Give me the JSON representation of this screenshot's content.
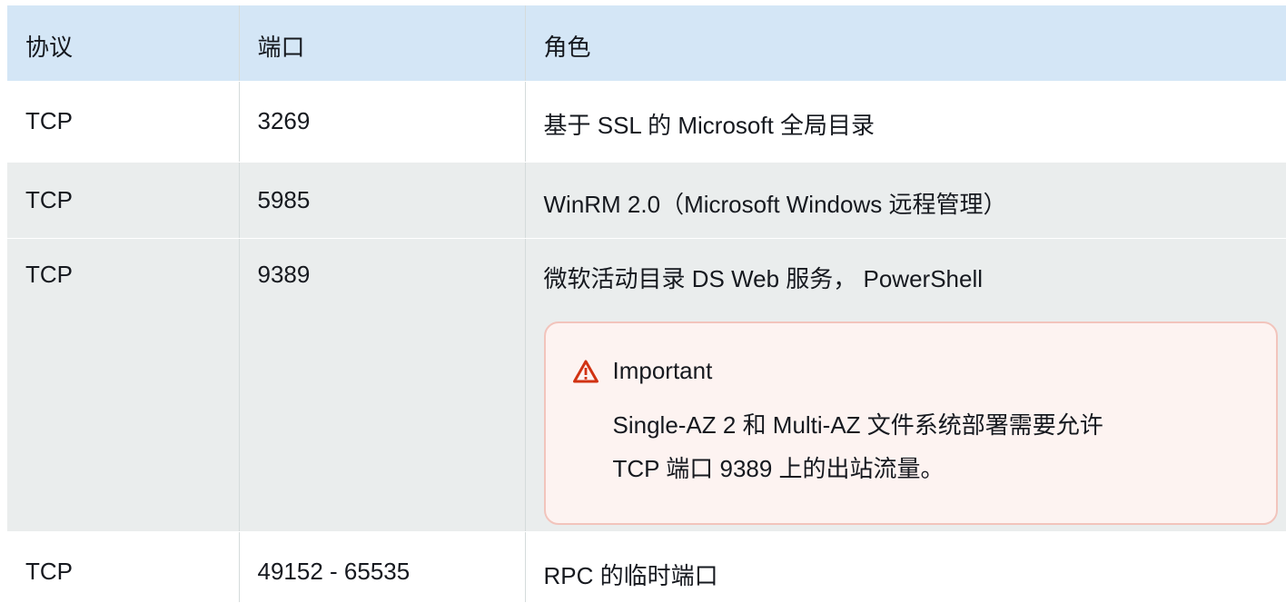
{
  "table": {
    "headers": [
      "协议",
      "端口",
      "角色"
    ],
    "rows": [
      {
        "protocol": "TCP",
        "port": "3269",
        "role": "基于 SSL 的 Microsoft 全局目录"
      },
      {
        "protocol": "TCP",
        "port": "5985",
        "role": "WinRM 2.0（Microsoft Windows 远程管理）"
      },
      {
        "protocol": "TCP",
        "port": "9389",
        "role": "微软活动目录 DS Web 服务， PowerShell"
      },
      {
        "protocol": "TCP",
        "port": "49152 - 65535",
        "role": "RPC 的临时端口"
      }
    ]
  },
  "alert": {
    "icon": "warning-triangle-icon",
    "title": "Important",
    "line1": "Single-AZ 2 和 Multi-AZ 文件系统部署需要允许",
    "line2": "TCP 端口 9389 上的出站流量。",
    "color": "#d13212"
  }
}
